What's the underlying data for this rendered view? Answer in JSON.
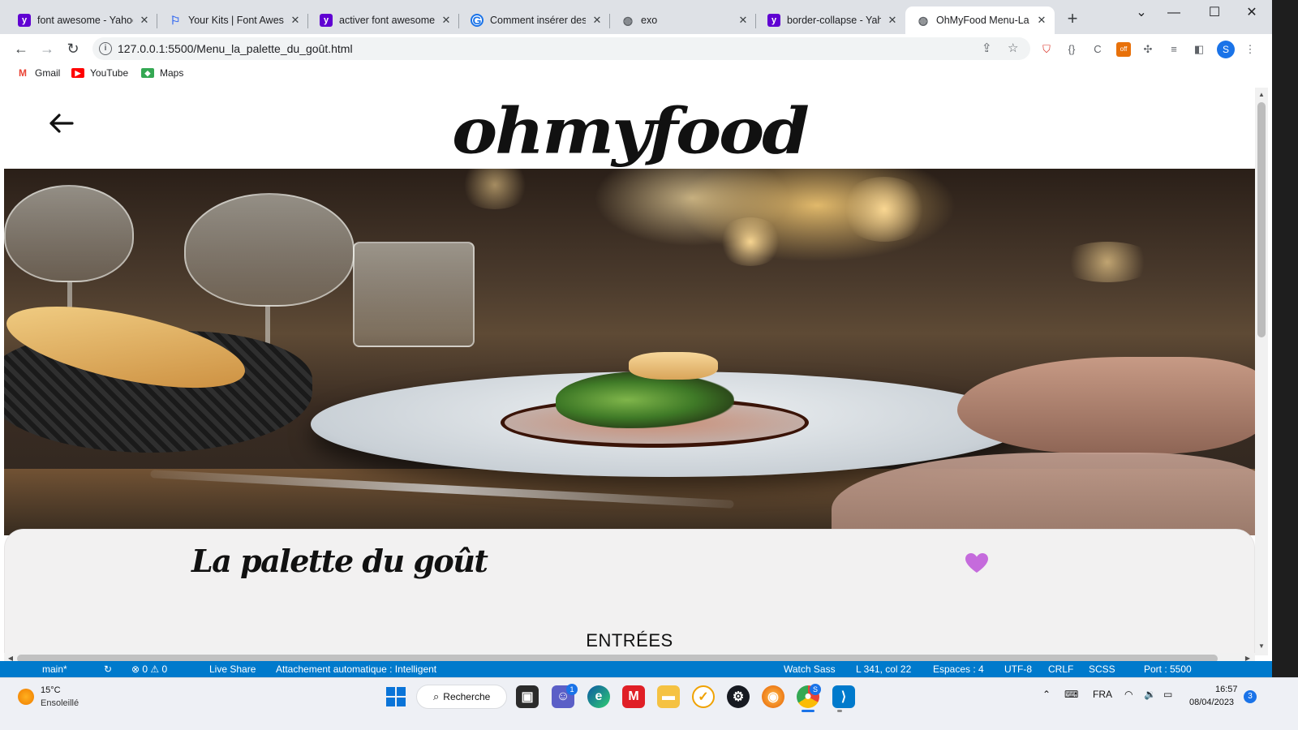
{
  "browser": {
    "tabs": [
      {
        "title": "font awesome - Yahoo",
        "favicon": "yahoo-icon",
        "active": false
      },
      {
        "title": "Your Kits | Font Awesome",
        "favicon": "font-awesome-flag-icon",
        "active": false
      },
      {
        "title": "activer font awesome -",
        "favicon": "yahoo-icon",
        "active": false
      },
      {
        "title": "Comment insérer des ic",
        "favicon": "google-icon",
        "active": false
      },
      {
        "title": "exo",
        "favicon": "globe-icon",
        "active": false
      },
      {
        "title": "border-collapse - Yahoo",
        "favicon": "yahoo-icon",
        "active": false
      },
      {
        "title": "OhMyFood Menu-La pa",
        "favicon": "globe-icon",
        "active": true
      }
    ],
    "url": "127.0.0.1:5500/Menu_la_palette_du_goût.html",
    "bookmarks": [
      {
        "label": "Gmail",
        "icon": "gmail-icon"
      },
      {
        "label": "YouTube",
        "icon": "youtube-icon"
      },
      {
        "label": "Maps",
        "icon": "maps-icon"
      }
    ],
    "profile_initial": "S",
    "extension_badge": "off"
  },
  "page": {
    "logo": "ohmyfood",
    "restaurant_name": "La palette du goût",
    "section_title": "ENTRÉES",
    "heart_color": "#c56bdc"
  },
  "vscode_status": {
    "branch": "main*",
    "errors_warnings": "⊗ 0 ⚠ 0",
    "live_share": "Live Share",
    "attach": "Attachement automatique : Intelligent",
    "watch_sass": "Watch Sass",
    "position": "L 341, col 22",
    "spaces": "Espaces : 4",
    "encoding": "UTF-8",
    "eol": "CRLF",
    "language": "SCSS",
    "port": "Port : 5500"
  },
  "taskbar": {
    "weather_temp": "15°C",
    "weather_desc": "Ensoleillé",
    "search_label": "Recherche",
    "chat_badge": "1",
    "chrome_badge": "S",
    "language": "FRA",
    "time": "16:57",
    "date": "08/04/2023",
    "notification_count": "3"
  },
  "colors": {
    "vscode_blue": "#007acc",
    "accent": "#1a73e8",
    "card_bg": "#f2f1f1"
  }
}
